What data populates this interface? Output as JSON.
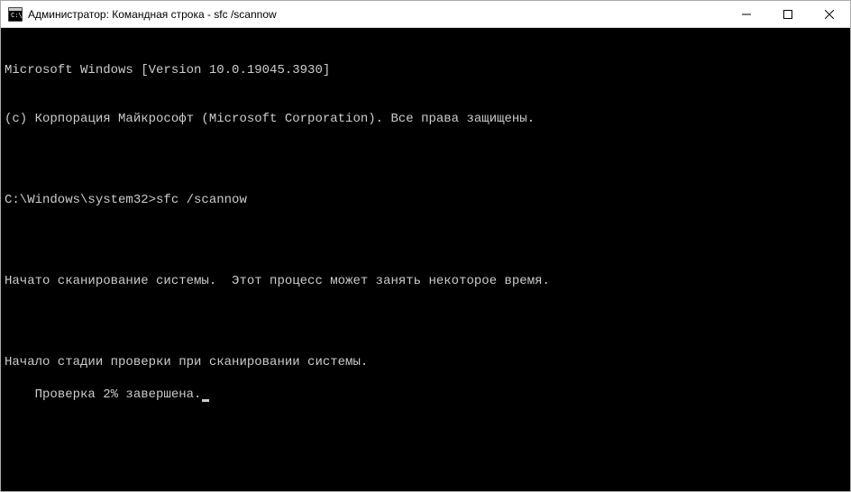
{
  "window": {
    "title": "Администратор: Командная строка - sfc  /scannow"
  },
  "terminal": {
    "lines": [
      "Microsoft Windows [Version 10.0.19045.3930]",
      "(c) Корпорация Майкрософт (Microsoft Corporation). Все права защищены.",
      "",
      "C:\\Windows\\system32>sfc /scannow",
      "",
      "Начато сканирование системы.  Этот процесс может занять некоторое время.",
      "",
      "Начало стадии проверки при сканировании системы.",
      "Проверка 2% завершена."
    ]
  }
}
